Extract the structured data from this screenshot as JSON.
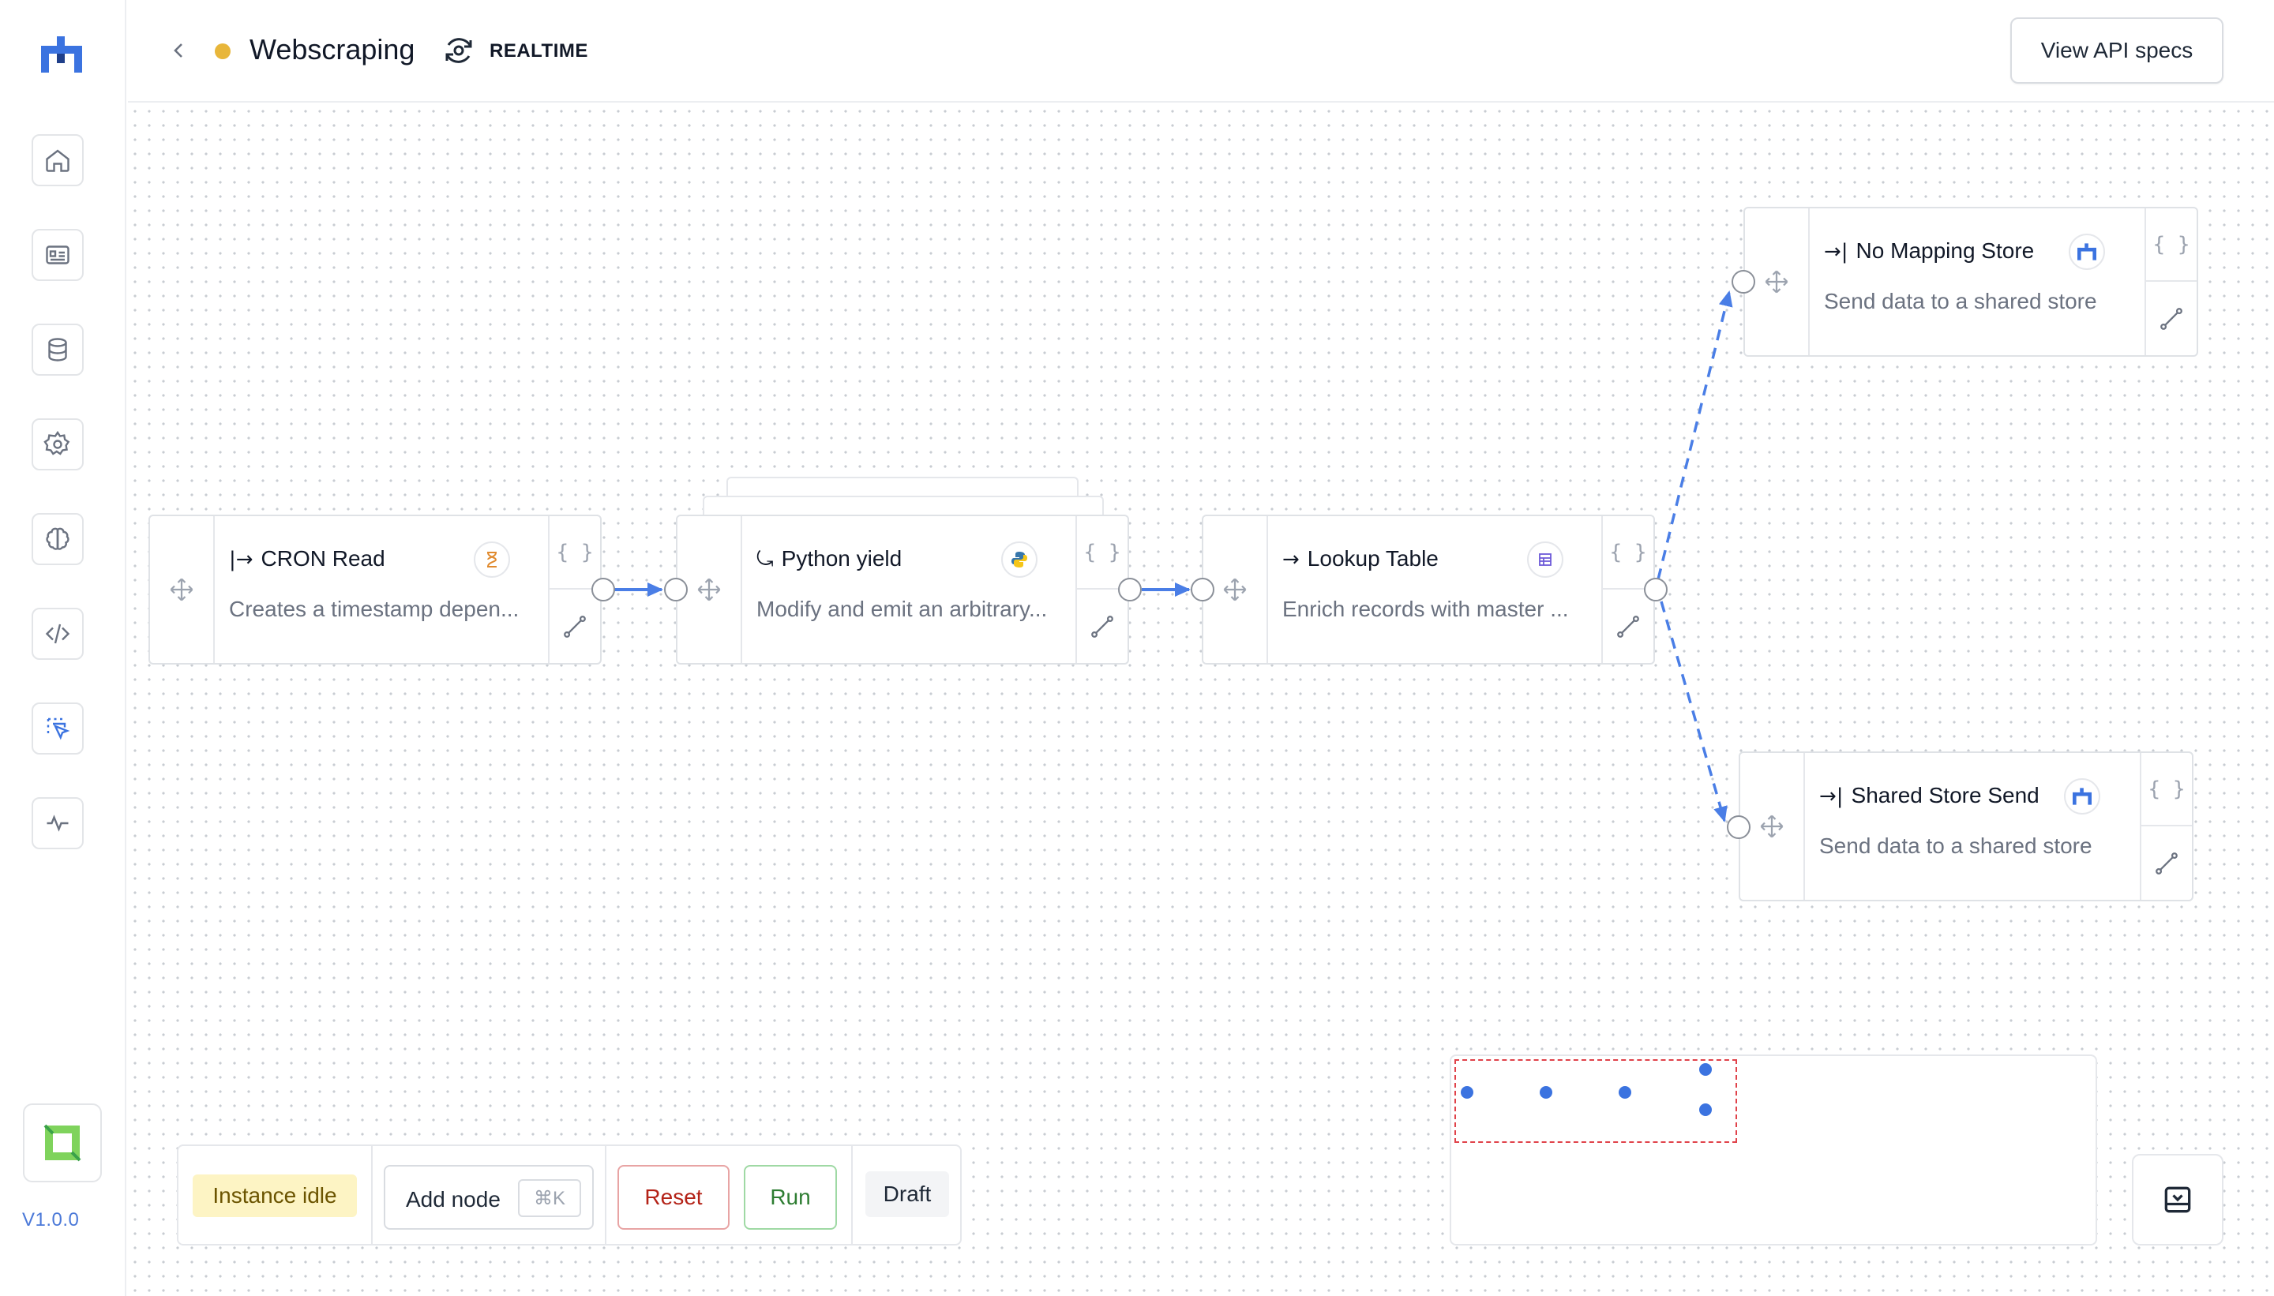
{
  "app": {
    "version": "V1.0.0"
  },
  "header": {
    "pipeline_name": "Webscraping",
    "status": "idle",
    "mode_label": "REALTIME",
    "api_button": "View API specs"
  },
  "sidebar": {
    "items": [
      {
        "name": "home",
        "icon": "home-icon"
      },
      {
        "name": "pipelines",
        "icon": "id-card-icon"
      },
      {
        "name": "stores",
        "icon": "database-icon"
      },
      {
        "name": "settings",
        "icon": "gear-icon"
      },
      {
        "name": "models",
        "icon": "brain-icon"
      },
      {
        "name": "code",
        "icon": "code-icon"
      },
      {
        "name": "builder",
        "icon": "cursor-select-icon",
        "active": true
      },
      {
        "name": "monitoring",
        "icon": "activity-icon"
      }
    ]
  },
  "nodes": [
    {
      "id": "cron",
      "arrow": "|→",
      "title": "CRON Read",
      "description": "Creates a timestamp depen...",
      "badge": "hourglass-icon"
    },
    {
      "id": "python",
      "arrow": "⤿",
      "title": "Python yield",
      "description": "Modify and emit an arbitrary...",
      "badge": "python-icon"
    },
    {
      "id": "lookup",
      "arrow": "→",
      "title": "Lookup Table",
      "description": "Enrich records with master ...",
      "badge": "table-icon"
    },
    {
      "id": "nomap",
      "arrow": "→|",
      "title": "No Mapping Store",
      "description": "Send data to a shared store",
      "badge": "store-logo-icon"
    },
    {
      "id": "shared",
      "arrow": "→|",
      "title": "Shared Store Send",
      "description": "Send data to a shared store",
      "badge": "store-logo-icon"
    }
  ],
  "node_side": {
    "braces": "{ }"
  },
  "toolbar": {
    "instance_status": "Instance idle",
    "add_node": "Add node",
    "shortcut": "⌘K",
    "reset": "Reset",
    "run": "Run",
    "draft": "Draft"
  },
  "colors": {
    "accent": "#3b73e0",
    "status_dot": "#e8b63a",
    "edge": "#4a7ee6",
    "reset": "#b42318",
    "run": "#2e7d32",
    "idle_bg": "#fdf4c4"
  }
}
